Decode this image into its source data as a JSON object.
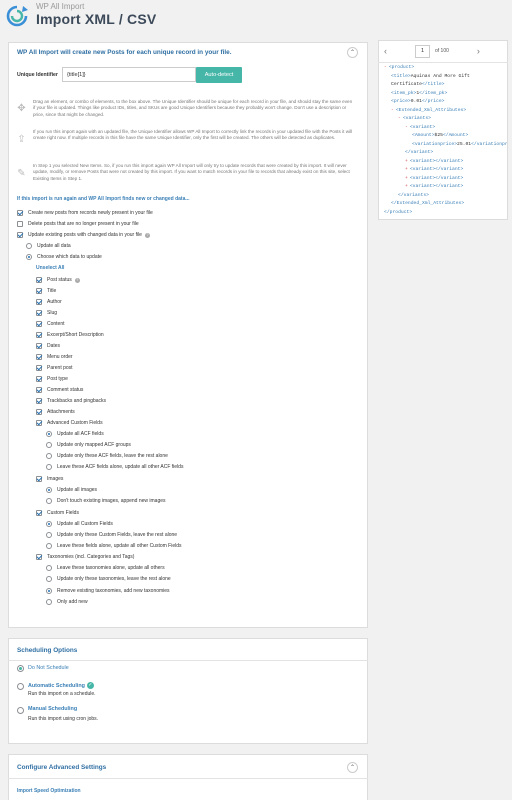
{
  "header": {
    "brand": "WP All Import",
    "title": "Import XML / CSV"
  },
  "unique_panel": {
    "heading": "WP All Import will create new Posts for each unique record in your file.",
    "uid_label": "Unique Identifier",
    "uid_value": "{title[1]}",
    "autodetect_label": "Auto-detect",
    "info1": "Drag an element, or combo of elements, to the box above. The Unique Identifier should be unique for each record in your file, and should stay the same even if your file is updated. Things like product IDs, titles, and SKUs are good Unique Identifiers because they probably won't change. Don't use a description or price, since that might be changed.",
    "info2": "If you run this import again with an updated file, the Unique Identifier allows WP All Import to correctly link the records in your updated file with the Posts it will create right now. If multiple records in this file have the same Unique Identifier, only the first will be created. The others will be detected as duplicates.",
    "info3": "In Step 1 you selected New Items. So, if you run this import again WP All Import will only try to update records that were created by this import. It will never update, modify, or remove Posts that were not created by this import. If you want to match records in your file to records that already exist on this site, select Existing Items in Step 1.",
    "rerun_heading": "If this import is run again and WP All Import finds new or changed data...",
    "opt_create": "Create new posts from records newly present in your file",
    "opt_delete": "Delete posts that are no longer present in your file",
    "opt_update": "Update existing posts with changed data in your file",
    "opt_update_all": "Update all data",
    "opt_choose": "Choose which data to update",
    "unselect_all": "Unselect All",
    "fields": {
      "post_status": "Post status",
      "title": "Title",
      "author": "Author",
      "slug": "Slug",
      "content": "Content",
      "excerpt": "Excerpt/Short Description",
      "dates": "Dates",
      "menu_order": "Menu order",
      "parent_post": "Parent post",
      "post_type": "Post type",
      "comment_status": "Comment status",
      "trackbacks": "Trackbacks and pingbacks",
      "attachments": "Attachments",
      "acf": "Advanced Custom Fields",
      "acf_all": "Update all ACF fields",
      "acf_mapped": "Update only mapped ACF groups",
      "acf_only": "Update only these ACF fields, leave the rest alone",
      "acf_leave": "Leave these ACF fields alone, update all other ACF fields",
      "images": "Images",
      "img_all": "Update all images",
      "img_append": "Don't touch existing images, append new images",
      "custom": "Custom Fields",
      "cf_all": "Update all Custom Fields",
      "cf_only": "Update only these Custom Fields, leave the rest alone",
      "cf_leave": "Leave these fields alone, update all other Custom Fields",
      "tax": "Taxonomies (incl. Categories and Tags)",
      "tax_leave": "Leave these taxonomies alone, update all others",
      "tax_only": "Update only these taxonomies, leave the rest alone",
      "tax_remove": "Remove existing taxonomies, add new taxonomies",
      "tax_add": "Only add new"
    }
  },
  "scheduling": {
    "heading": "Scheduling Options",
    "do_not": "Do Not Schedule",
    "auto": "Automatic Scheduling",
    "auto_desc": "Run this import on a schedule.",
    "manual": "Manual Scheduling",
    "manual_desc": "Run this import using cron jobs."
  },
  "advanced": {
    "heading": "Configure Advanced Settings",
    "speed": "Import Speed Optimization"
  },
  "xml_panel": {
    "page": "1",
    "of": "of 100",
    "lines": [
      {
        "ind": 0,
        "pm": "-",
        "parts": [
          [
            "tag",
            "<product>"
          ]
        ]
      },
      {
        "ind": 1,
        "pm": "",
        "parts": [
          [
            "tag",
            "<title>"
          ],
          [
            "tx",
            "Aquinas And More Gift"
          ]
        ]
      },
      {
        "ind": 1,
        "pm": "",
        "parts": [
          [
            "tx",
            "Certificate"
          ],
          [
            "tag",
            "</title>"
          ]
        ]
      },
      {
        "ind": 1,
        "pm": "",
        "parts": [
          [
            "tag",
            "<item_pk>"
          ],
          [
            "tx",
            "1"
          ],
          [
            "tag",
            "</item_pk>"
          ]
        ]
      },
      {
        "ind": 1,
        "pm": "",
        "parts": [
          [
            "tag",
            "<price>"
          ],
          [
            "tx",
            "0.01"
          ],
          [
            "tag",
            "</price>"
          ]
        ]
      },
      {
        "ind": 1,
        "pm": "-",
        "parts": [
          [
            "tag",
            "<Extended_Xml_Attributes>"
          ]
        ]
      },
      {
        "ind": 2,
        "pm": "-",
        "parts": [
          [
            "tag",
            "<variants>"
          ]
        ]
      },
      {
        "ind": 3,
        "pm": "-",
        "parts": [
          [
            "tag",
            "<variant>"
          ]
        ]
      },
      {
        "ind": 4,
        "pm": "",
        "parts": [
          [
            "tag",
            "<Amount>"
          ],
          [
            "tx",
            "$25"
          ],
          [
            "tag",
            "</Amount>"
          ]
        ]
      },
      {
        "ind": 4,
        "pm": "",
        "parts": [
          [
            "tag",
            "<variationprice>"
          ],
          [
            "tx",
            "25.01"
          ],
          [
            "tag",
            "</variationprice>"
          ]
        ]
      },
      {
        "ind": 3,
        "pm": "",
        "parts": [
          [
            "tag",
            "</variant>"
          ]
        ]
      },
      {
        "ind": 3,
        "pm": "+",
        "parts": [
          [
            "tag",
            "<variant>"
          ],
          [
            "tag",
            "</variant>"
          ]
        ]
      },
      {
        "ind": 3,
        "pm": "+",
        "parts": [
          [
            "tag",
            "<variant>"
          ],
          [
            "tag",
            "</variant>"
          ]
        ]
      },
      {
        "ind": 3,
        "pm": "+",
        "parts": [
          [
            "tag",
            "<variant>"
          ],
          [
            "tag",
            "</variant>"
          ]
        ]
      },
      {
        "ind": 3,
        "pm": "+",
        "parts": [
          [
            "tag",
            "<variant>"
          ],
          [
            "tag",
            "</variant>"
          ]
        ]
      },
      {
        "ind": 2,
        "pm": "",
        "parts": [
          [
            "tag",
            "</variants>"
          ]
        ]
      },
      {
        "ind": 1,
        "pm": "",
        "parts": [
          [
            "tag",
            "</Extended_Xml_Attributes>"
          ]
        ]
      },
      {
        "ind": 0,
        "pm": "",
        "parts": [
          [
            "tag",
            "</product>"
          ]
        ]
      }
    ]
  },
  "icons": {
    "logo": "wp-all-import-logo-icon",
    "collapse": "chevron-up-icon",
    "move": "move-arrows-icon",
    "upload": "upload-icon",
    "pencil": "pencil-icon",
    "help": "help-icon",
    "check": "check-badge-icon"
  },
  "colors": {
    "accent": "#46b6a8",
    "link": "#3a7fb6",
    "title": "#3c4a5a"
  }
}
